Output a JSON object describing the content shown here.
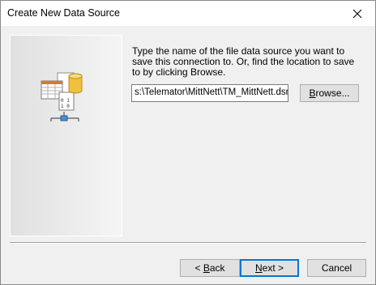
{
  "window": {
    "title": "Create New Data Source"
  },
  "main": {
    "description": "Type the name of the file data source you want to save this connection to.  Or, find the location to save to by clicking Browse.",
    "path_value": "s:\\Telemator\\MittNett\\TM_MittNett.dsn",
    "browse_label_pre": "",
    "browse_label_key": "B",
    "browse_label_post": "rowse..."
  },
  "footer": {
    "back_arrow": "< ",
    "back_key": "B",
    "back_rest": "ack",
    "next_key": "N",
    "next_rest": "ext >",
    "cancel_label": "Cancel"
  },
  "icons": {
    "close": "close-icon",
    "wizard": "data-source-wizard-icon"
  }
}
